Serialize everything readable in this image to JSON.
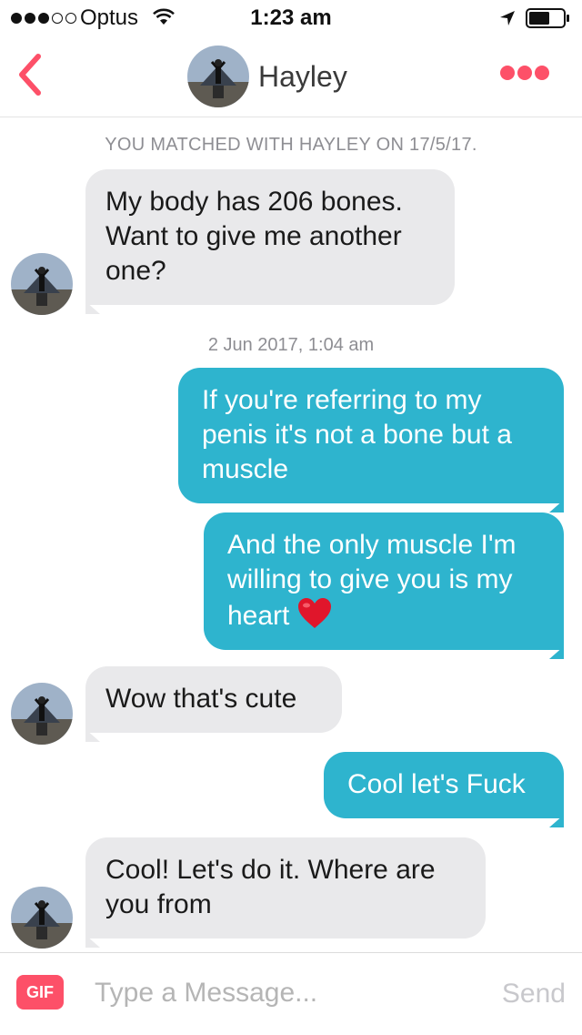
{
  "status_bar": {
    "carrier": "Optus",
    "signal_bars_filled": 3,
    "signal_bars_total": 5,
    "time": "1:23 am"
  },
  "header": {
    "back_icon": "chevron-left-icon",
    "name": "Hayley",
    "more_icon": "more-dots-icon"
  },
  "chat": {
    "match_note": "YOU MATCHED WITH HAYLEY ON 17/5/17.",
    "messages": [
      {
        "sender": "Hayley",
        "direction": "incoming",
        "text": "My body has 206 bones. Want to give me another one?"
      },
      {
        "type": "timestamp",
        "text": "2 Jun 2017, 1:04 am"
      },
      {
        "sender": "me",
        "direction": "outgoing",
        "text": "If you're referring to my penis it's not a bone but a muscle"
      },
      {
        "sender": "me",
        "direction": "outgoing",
        "text": "And the only muscle I'm willing to give you is my heart",
        "emoji": "red-heart"
      },
      {
        "sender": "Hayley",
        "direction": "incoming",
        "text": "Wow that's cute"
      },
      {
        "sender": "me",
        "direction": "outgoing",
        "text": "Cool let's Fuck"
      },
      {
        "sender": "Hayley",
        "direction": "incoming",
        "text": "Cool! Let's do it. Where are you from"
      }
    ]
  },
  "input_bar": {
    "gif_label": "GIF",
    "placeholder": "Type a Message...",
    "value": "",
    "send_label": "Send"
  },
  "colors": {
    "accent": "#fd5068",
    "outgoing_bubble": "#2eb4ce",
    "incoming_bubble": "#e9e9eb",
    "meta_text": "#8e8e93"
  }
}
